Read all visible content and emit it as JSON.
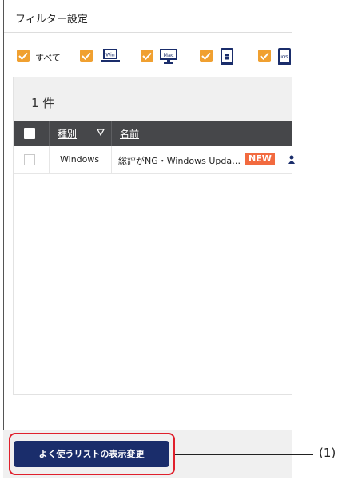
{
  "panel": {
    "title": "フィルター設定"
  },
  "filters": {
    "all_label": "すべて",
    "all_checked": true,
    "os_items": [
      {
        "icon": "windows-laptop-icon",
        "text": "Win",
        "checked": true
      },
      {
        "icon": "mac-monitor-icon",
        "text": "Mac",
        "checked": true
      },
      {
        "icon": "android-phone-icon",
        "checked": true
      },
      {
        "icon": "ios-phone-icon",
        "text": "iOS",
        "checked": true
      }
    ],
    "accent_color": "#f0a030"
  },
  "list": {
    "count_text": "1 件",
    "columns": {
      "type": "種別",
      "name": "名前"
    },
    "rows": [
      {
        "type": "Windows",
        "name": "総評がNG・Windows Upda…",
        "badge": "NEW",
        "checked": false
      }
    ]
  },
  "footer": {
    "button_label": "よく使うリストの表示変更",
    "button_color": "#1a2d6b"
  },
  "annotation": {
    "label": "(1)",
    "highlight_color": "#e0202c"
  }
}
